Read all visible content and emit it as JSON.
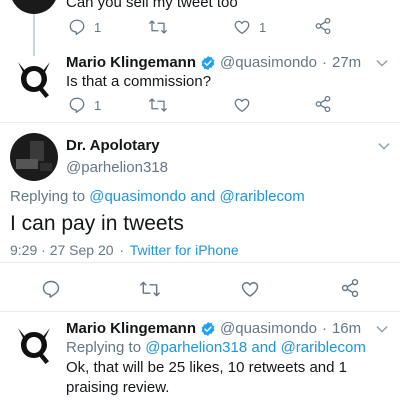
{
  "tweet1": {
    "text": "Can you sell my tweet too",
    "reply_count": "1",
    "like_count": "1"
  },
  "tweet2": {
    "name": "Mario Klingemann",
    "handle": "@quasimondo",
    "sep": "·",
    "time": "27m",
    "text": "Is that a commission?",
    "reply_count": "1"
  },
  "tweet3": {
    "name": "Dr. Apolotary",
    "handle": "@parhelion318",
    "replying_prefix": "Replying to",
    "replying_1": "@quasimondo",
    "replying_and": "and",
    "replying_2": "@raribleсom",
    "text": "I can pay in tweets",
    "timestamp": "9:29 · 27 Sep 20",
    "sep": "·",
    "source": "Twitter for iPhone"
  },
  "tweet4": {
    "name": "Mario Klingemann",
    "handle": "@quasimondo",
    "sep": "·",
    "time": "16m",
    "replying_prefix": "Replying to",
    "replying_1": "@parhelion318",
    "replying_and": "and",
    "replying_2": "@raribleсom",
    "text": "Ok, that will be 25 likes, 10 retweets and 1 praising review."
  },
  "colors": {
    "accent": "#1b95e0",
    "text": "#14171a",
    "secondary": "#657786",
    "divider": "#e6ecf0"
  },
  "icons": [
    "reply-icon",
    "retweet-icon",
    "like-icon",
    "share-icon",
    "verified-icon",
    "chevron-down-icon"
  ]
}
